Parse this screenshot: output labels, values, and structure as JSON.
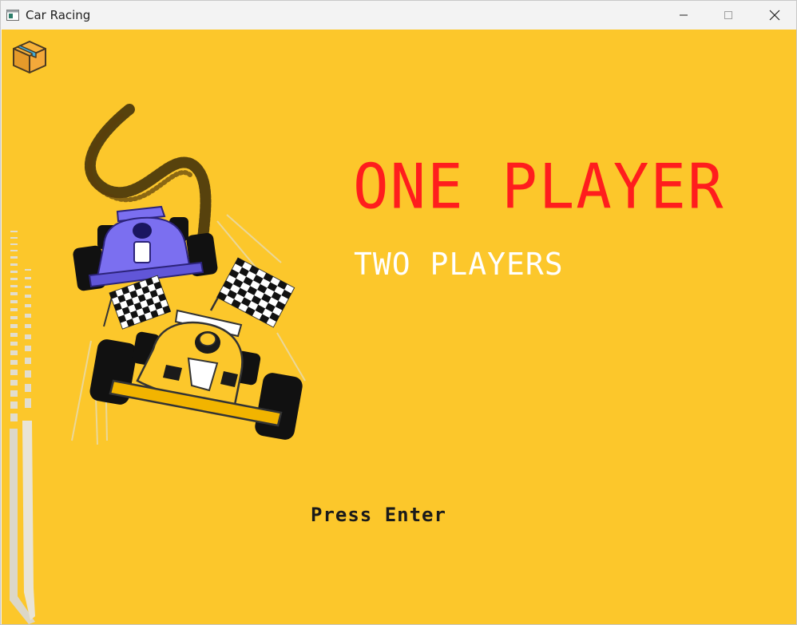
{
  "window": {
    "title": "Car Racing",
    "app_icon": "window-app-icon",
    "controls": [
      "minimize-icon",
      "maximize-icon",
      "close-icon"
    ]
  },
  "game": {
    "menu_items": [
      {
        "label": "ONE PLAYER",
        "selected": true
      },
      {
        "label": "TWO PLAYERS",
        "selected": false
      }
    ],
    "prompt": "Press Enter",
    "colors": {
      "background": "#fcc72b",
      "selected_item": "#ff1d1d",
      "unselected_item": "#ffffff",
      "prompt": "#1a1a1a"
    },
    "corner_icon": "package-box-icon",
    "illustration": "racing-cars-with-checkered-flags"
  }
}
